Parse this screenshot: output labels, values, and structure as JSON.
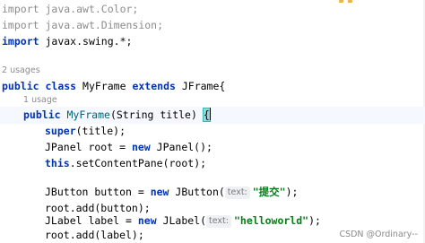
{
  "editor": {
    "imports": [
      {
        "kw": "import",
        "path": "java.awt.Color;"
      },
      {
        "kw": "import",
        "path": "java.awt.Dimension;"
      },
      {
        "kw": "import",
        "path": "javax.swing.*;"
      }
    ],
    "class_usages": "2 usages",
    "class_decl": {
      "kw1": "public",
      "kw2": "class",
      "name": "MyFrame",
      "kw3": "extends",
      "parent": "JFrame",
      "brace": "{"
    },
    "ctor_usages": "1 usage",
    "ctor_decl": {
      "kw": "public",
      "name": "MyFrame",
      "params": "(String title) ",
      "brace": "{"
    },
    "lines": {
      "super_kw": "super",
      "super_rest": "(title);",
      "panel_a": "JPanel root = ",
      "panel_kw": "new",
      "panel_b": " JPanel();",
      "this_kw": "this",
      "this_dot": ".",
      "this_method": "setContentPane",
      "this_rest": "(root);",
      "button_a": "JButton button = ",
      "button_kw": "new",
      "button_b": " JButton(",
      "button_hint": "text:",
      "button_str": "\"提交\"",
      "button_end": ");",
      "add_button": "root.add(button);",
      "label_a": "JLabel label = ",
      "label_kw": "new",
      "label_b": " JLabel(",
      "label_hint": "text:",
      "label_str": "\"helloworld\"",
      "label_end": ");",
      "add_label": "root.add(label);"
    },
    "watermark": "CSDN @Ordinary--"
  },
  "colors": {
    "keyword": "#0033b3",
    "string": "#067d17",
    "method": "#00627a",
    "comment_gray": "#8c8c8c",
    "caret_line": "#f5f8fe",
    "brace_match": "#93d9d9"
  }
}
